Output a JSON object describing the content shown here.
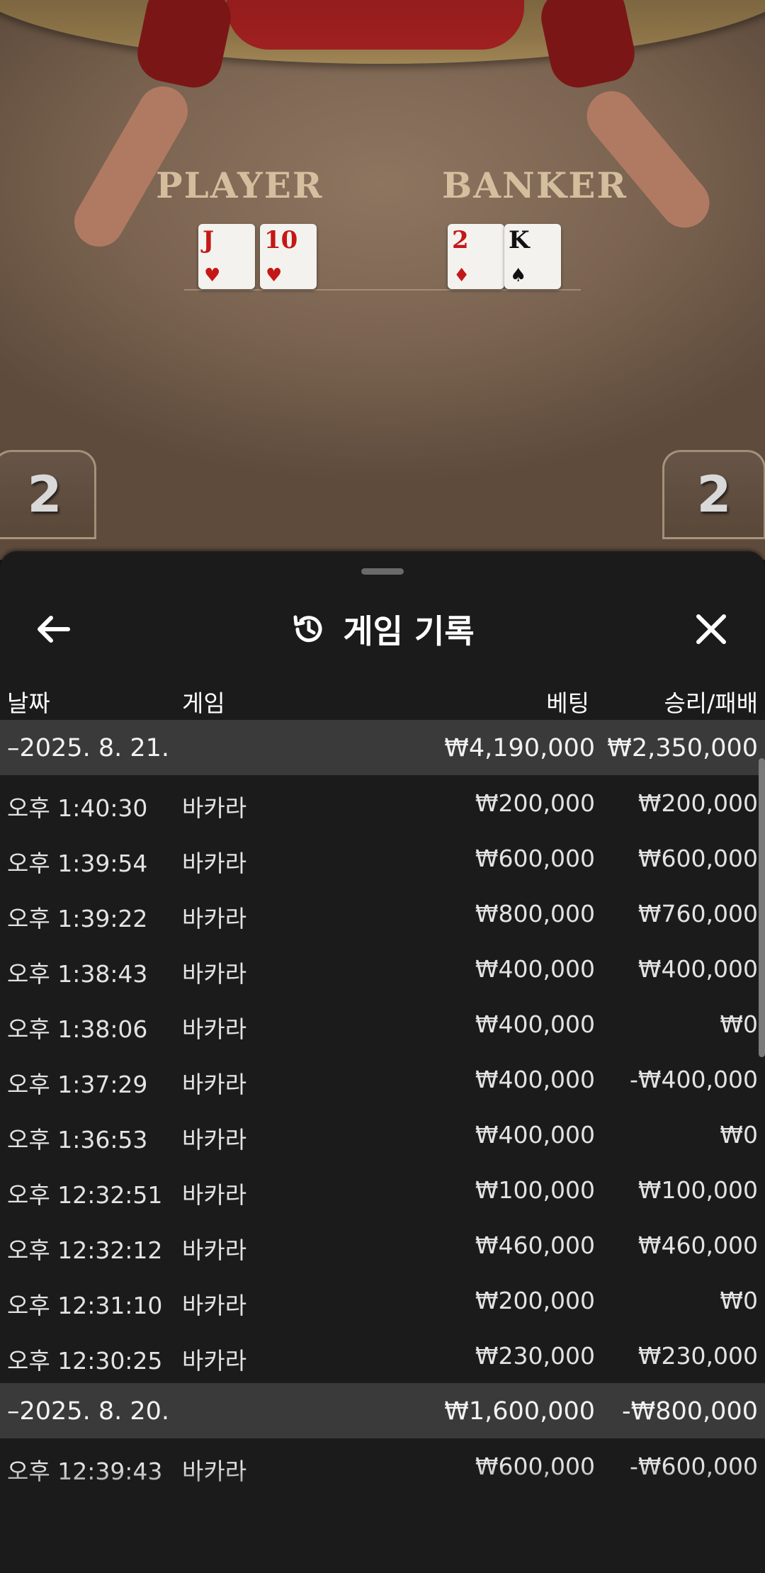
{
  "video": {
    "player_label": "PLAYER",
    "banker_label": "BANKER",
    "player_score": "2",
    "banker_score": "2",
    "cards": [
      {
        "rank": "J",
        "suit": "♥",
        "color": "red"
      },
      {
        "rank": "10",
        "suit": "♥",
        "color": "red"
      },
      {
        "rank": "2",
        "suit": "♦",
        "color": "red"
      },
      {
        "rank": "K",
        "suit": "♠",
        "color": "black"
      }
    ]
  },
  "sheet": {
    "title": "게임 기록",
    "back_icon": "arrow-left-icon",
    "history_icon": "history-icon",
    "close_icon": "close-icon"
  },
  "columns": {
    "date": "날짜",
    "game": "게임",
    "bet": "베팅",
    "result": "승리/패배"
  },
  "groups": [
    {
      "date": "–2025. 8. 21.",
      "bet_total": "₩4,190,000",
      "result_total": "₩2,350,000",
      "rows": [
        {
          "time": "오후 1:40:30",
          "game": "바카라",
          "bet": "₩200,000",
          "result": "₩200,000"
        },
        {
          "time": "오후 1:39:54",
          "game": "바카라",
          "bet": "₩600,000",
          "result": "₩600,000"
        },
        {
          "time": "오후 1:39:22",
          "game": "바카라",
          "bet": "₩800,000",
          "result": "₩760,000"
        },
        {
          "time": "오후 1:38:43",
          "game": "바카라",
          "bet": "₩400,000",
          "result": "₩400,000"
        },
        {
          "time": "오후 1:38:06",
          "game": "바카라",
          "bet": "₩400,000",
          "result": "₩0"
        },
        {
          "time": "오후 1:37:29",
          "game": "바카라",
          "bet": "₩400,000",
          "result": "-₩400,000"
        },
        {
          "time": "오후 1:36:53",
          "game": "바카라",
          "bet": "₩400,000",
          "result": "₩0"
        },
        {
          "time": "오후 12:32:51",
          "game": "바카라",
          "bet": "₩100,000",
          "result": "₩100,000"
        },
        {
          "time": "오후 12:32:12",
          "game": "바카라",
          "bet": "₩460,000",
          "result": "₩460,000"
        },
        {
          "time": "오후 12:31:10",
          "game": "바카라",
          "bet": "₩200,000",
          "result": "₩0"
        },
        {
          "time": "오후 12:30:25",
          "game": "바카라",
          "bet": "₩230,000",
          "result": "₩230,000"
        }
      ]
    },
    {
      "date": "–2025. 8. 20.",
      "bet_total": "₩1,600,000",
      "result_total": "-₩800,000",
      "rows": [
        {
          "time": "오후 12:39:43",
          "game": "바카라",
          "bet": "₩600,000",
          "result": "-₩600,000"
        }
      ]
    }
  ]
}
